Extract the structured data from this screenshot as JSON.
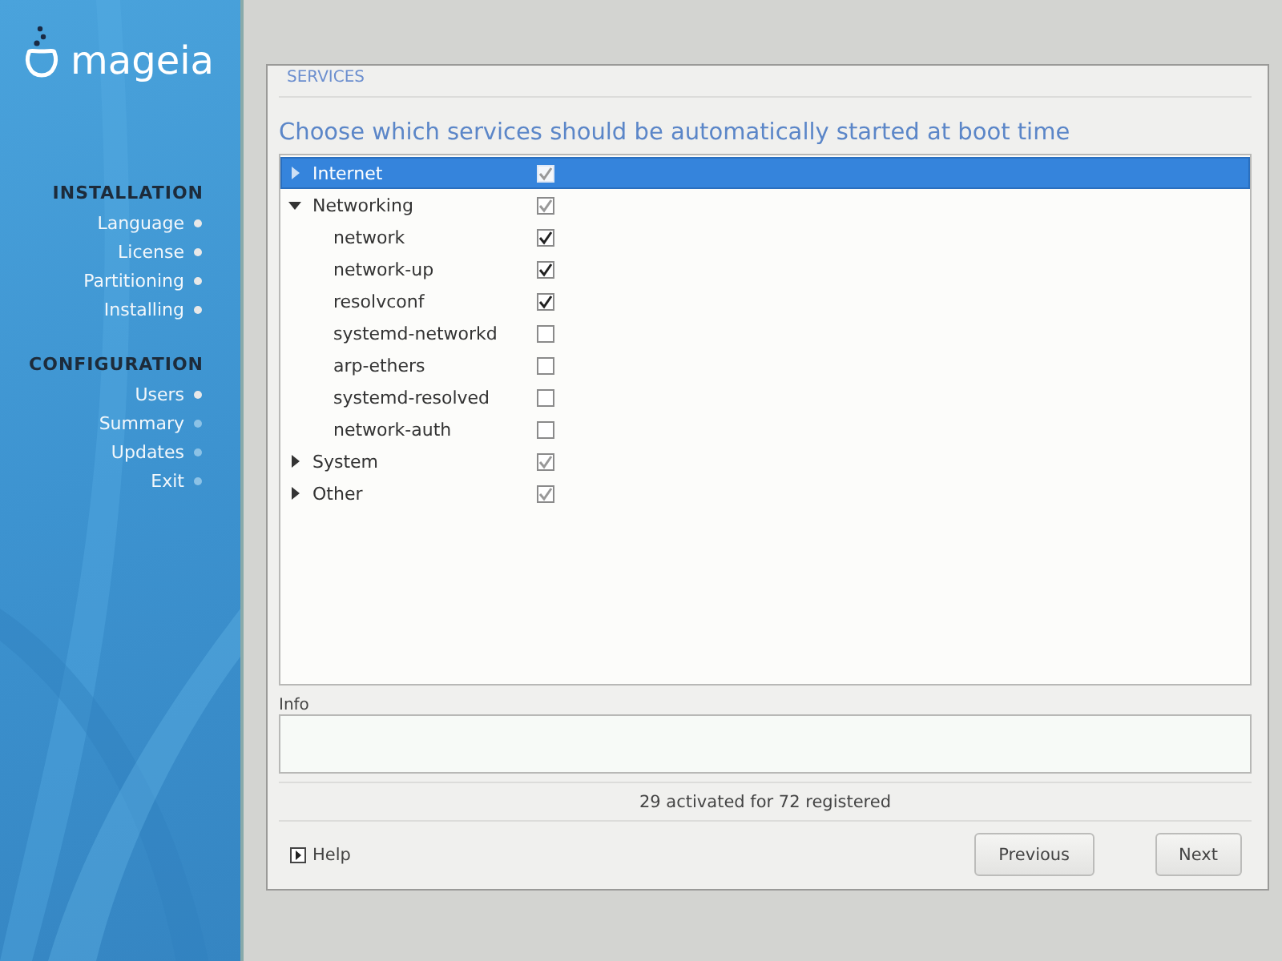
{
  "sidebar": {
    "logo": "mageia",
    "sections": [
      {
        "title": "INSTALLATION",
        "steps": [
          {
            "label": "Language",
            "done": true
          },
          {
            "label": "License",
            "done": true
          },
          {
            "label": "Partitioning",
            "done": true
          },
          {
            "label": "Installing",
            "done": true
          }
        ]
      },
      {
        "title": "CONFIGURATION",
        "steps": [
          {
            "label": "Users",
            "done": true
          },
          {
            "label": "Summary",
            "done": false
          },
          {
            "label": "Updates",
            "done": false
          },
          {
            "label": "Exit",
            "done": false
          }
        ]
      }
    ]
  },
  "dialog": {
    "section_title": "SERVICES",
    "heading": "Choose which services should be automatically started at boot time",
    "tree": [
      {
        "label": "Internet",
        "checked": true,
        "expanded": false,
        "selected": true
      },
      {
        "label": "Networking",
        "checked": true,
        "expanded": true,
        "selected": false,
        "children": [
          {
            "label": "network",
            "checked": true,
            "selected": false
          },
          {
            "label": "network-up",
            "checked": true,
            "selected": false
          },
          {
            "label": "resolvconf",
            "checked": true,
            "selected": false
          },
          {
            "label": "systemd-networkd",
            "checked": false,
            "selected": false
          },
          {
            "label": "arp-ethers",
            "checked": false,
            "selected": false
          },
          {
            "label": "systemd-resolved",
            "checked": false,
            "selected": false
          },
          {
            "label": "network-auth",
            "checked": false,
            "selected": false
          }
        ]
      },
      {
        "label": "System",
        "checked": true,
        "expanded": false,
        "selected": false
      },
      {
        "label": "Other",
        "checked": true,
        "expanded": false,
        "selected": false
      }
    ],
    "info_label": "Info",
    "status": "29 activated for 72 registered",
    "help": "Help",
    "buttons": [
      "Previous",
      "Next"
    ]
  }
}
